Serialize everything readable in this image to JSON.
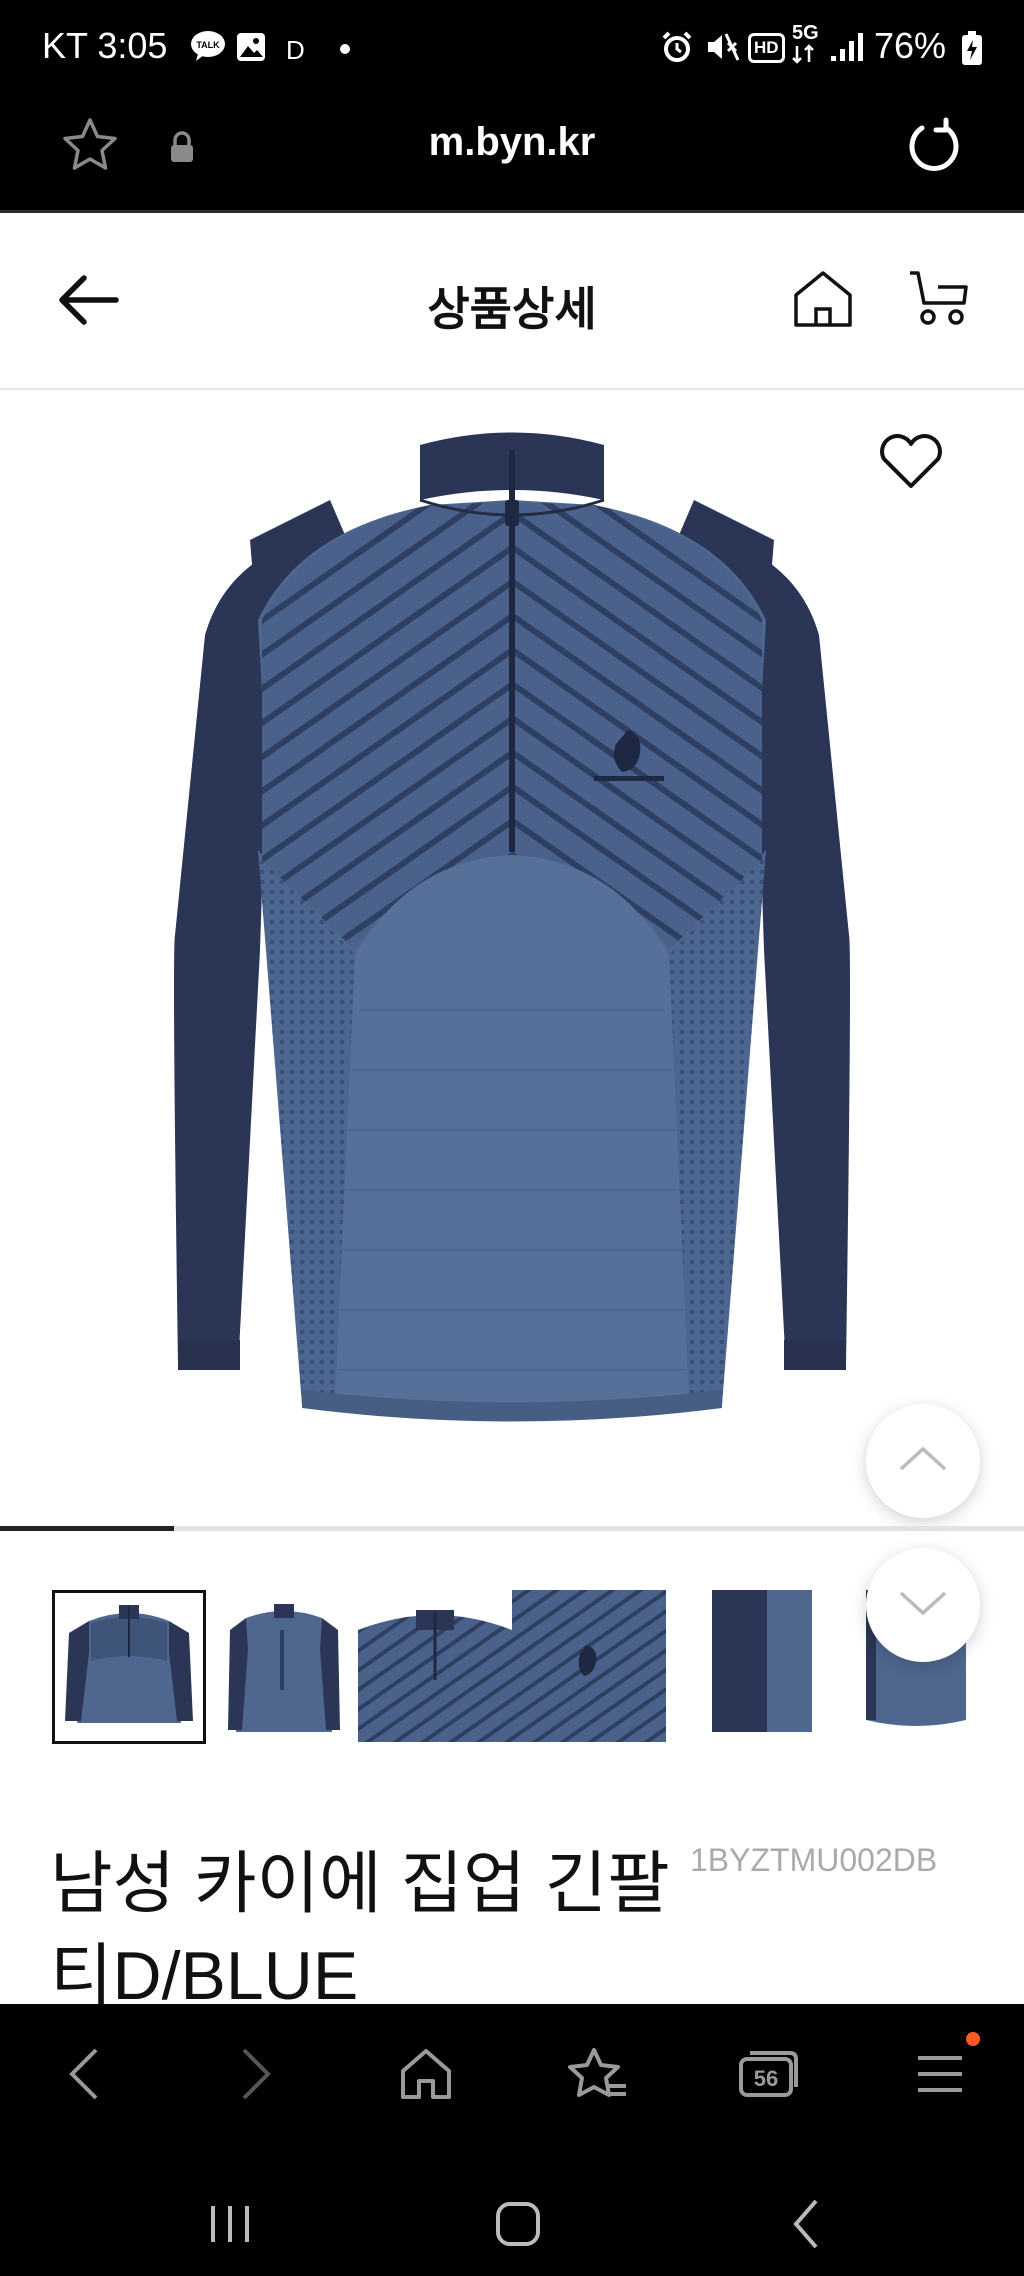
{
  "status_bar": {
    "carrier_time": "KT 3:05",
    "talk_badge": "TALK",
    "d_letter": "D",
    "hd_label": "HD",
    "fiveg_label": "5G",
    "battery": "76%"
  },
  "browser": {
    "url": "m.byn.kr",
    "tab_count": "56"
  },
  "header": {
    "title": "상품상세"
  },
  "product": {
    "title_line1": "남성 카이에 집업 긴팔",
    "title_line2": "티D/BLUE",
    "code": "1BYZTMU002DB",
    "thumbnail_count": 5,
    "gallery_progress": 0.17
  },
  "colors": {
    "navy": "#2b3656",
    "heather_blue": "#4f678f",
    "stripe": "#33446a",
    "notification_dot": "#ff5a1f"
  },
  "icons": {
    "back": "arrow-left-icon",
    "home": "home-icon",
    "cart": "cart-icon",
    "wishlist": "heart-icon",
    "scroll_up": "chevron-up-icon",
    "scroll_down": "chevron-down-icon"
  }
}
